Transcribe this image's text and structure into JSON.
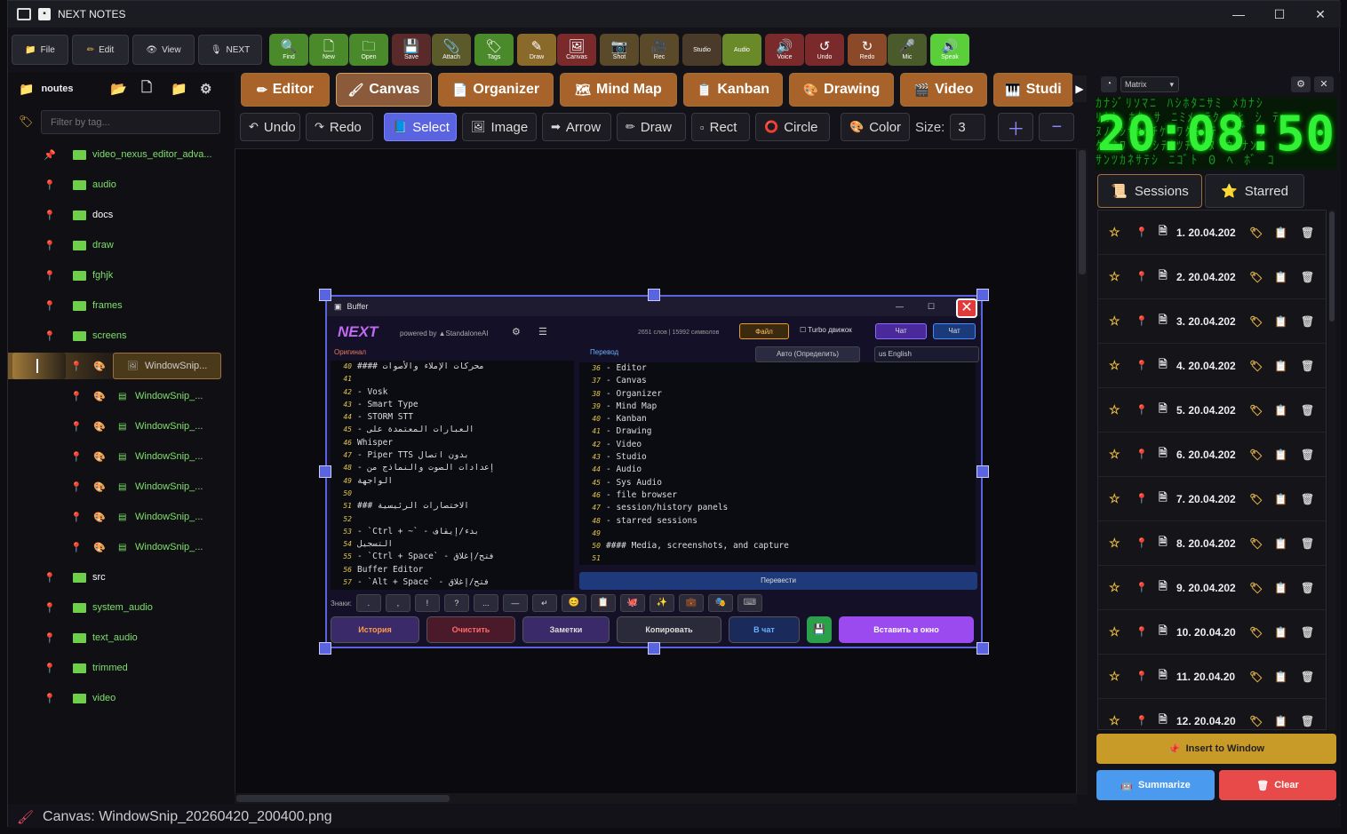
{
  "window": {
    "title": "NEXT NOTES"
  },
  "menus": [
    {
      "label": "File"
    },
    {
      "label": "Edit"
    },
    {
      "label": "View"
    },
    {
      "label": "NEXT"
    }
  ],
  "toolbar": [
    {
      "label": "Find",
      "icon": "🔍",
      "color": "#4a8a2a"
    },
    {
      "label": "New",
      "icon": "🗋",
      "color": "#4a8a2a"
    },
    {
      "label": "Open",
      "icon": "🗀",
      "color": "#4a8a2a"
    },
    {
      "label": "Save",
      "icon": "💾",
      "color": "#5a2a2a"
    },
    {
      "label": "Attach",
      "icon": "📎",
      "color": "#5a5a2a"
    },
    {
      "label": "Tags",
      "icon": "🏷",
      "color": "#4a8a2a"
    },
    {
      "label": "Draw",
      "icon": "✎",
      "color": "#8a6a2a"
    },
    {
      "label": "Canvas",
      "icon": "🖼",
      "color": "#7a2a2a"
    },
    {
      "label": "Shot",
      "icon": "📷",
      "color": "#5a4a2a"
    },
    {
      "label": "Rec",
      "icon": "🎥",
      "color": "#5a4a2a"
    },
    {
      "label": "Studio",
      "icon": "",
      "color": "#4a3a2a"
    },
    {
      "label": "Audio",
      "icon": "",
      "color": "#6a8a2a"
    },
    {
      "label": "Voice",
      "icon": "🔊",
      "color": "#7a2a2a"
    },
    {
      "label": "Undo",
      "icon": "↺",
      "color": "#7a2a2a"
    },
    {
      "label": "Redo",
      "icon": "↻",
      "color": "#8a4a2a"
    },
    {
      "label": "Mic",
      "icon": "🎤",
      "color": "#4a5a2a"
    },
    {
      "label": "Speak",
      "icon": "🔊",
      "color": "#5acf3a"
    }
  ],
  "sidebar": {
    "root": "noutes",
    "filter_placeholder": "Filter by tag...",
    "items": [
      {
        "label": "video_nexus_editor_adva...",
        "pin": "📌"
      },
      {
        "label": "audio"
      },
      {
        "label": "docs"
      },
      {
        "label": "draw"
      },
      {
        "label": "fghjk"
      },
      {
        "label": "frames"
      },
      {
        "label": "screens"
      }
    ],
    "files": [
      {
        "label": "WindowSnip..."
      },
      {
        "label": "WindowSnip_..."
      },
      {
        "label": "WindowSnip_..."
      },
      {
        "label": "WindowSnip_..."
      },
      {
        "label": "WindowSnip_..."
      },
      {
        "label": "WindowSnip_..."
      },
      {
        "label": "WindowSnip_..."
      }
    ],
    "items2": [
      {
        "label": "src"
      },
      {
        "label": "system_audio"
      },
      {
        "label": "text_audio"
      },
      {
        "label": "trimmed"
      },
      {
        "label": "video"
      }
    ]
  },
  "tabs": [
    {
      "label": "Editor",
      "icon": "✏",
      "color": "#a8632a"
    },
    {
      "label": "Canvas",
      "icon": "🖌",
      "color": "#8a5a3a"
    },
    {
      "label": "Organizer",
      "icon": "📄",
      "color": "#a8632a"
    },
    {
      "label": "Mind Map",
      "icon": "🗺",
      "color": "#a8632a"
    },
    {
      "label": "Kanban",
      "icon": "📋",
      "color": "#a8632a"
    },
    {
      "label": "Drawing",
      "icon": "🎨",
      "color": "#a8632a"
    },
    {
      "label": "Video",
      "icon": "🎬",
      "color": "#a8632a"
    },
    {
      "label": "Studi",
      "icon": "🎹",
      "color": "#a8632a"
    }
  ],
  "canvas_tools": [
    {
      "label": "Undo",
      "icon": "↶"
    },
    {
      "label": "Redo",
      "icon": "↷"
    },
    {
      "label": "Select",
      "icon": "📘",
      "active": true
    },
    {
      "label": "Image",
      "icon": "🖼"
    },
    {
      "label": "Arrow",
      "icon": "➡"
    },
    {
      "label": "Draw",
      "icon": "✏"
    },
    {
      "label": "Rect",
      "icon": "▫"
    },
    {
      "label": "Circle",
      "icon": "⭕"
    },
    {
      "label": "Color",
      "icon": "🎨"
    }
  ],
  "size": {
    "label": "Size:",
    "value": "3"
  },
  "snip": {
    "title": "Buffer",
    "brand": "NEXT",
    "powered": "powered by ▲StandaloneAI",
    "stats": "2651 слов | 15992 символов",
    "file_btn": "Файл",
    "turbo": "Turbo движок",
    "chat_btn1": "Чат",
    "chat_btn2": "Чат",
    "orig_label": "Оригинал",
    "trans_label": "Перевод",
    "auto_lang": "Авто (Определить)",
    "target_lang": "us English",
    "left_lines": [
      {
        "n": "40",
        "t": "#### محركات الإملاء والأصوات"
      },
      {
        "n": "41",
        "t": ""
      },
      {
        "n": "42",
        "t": "- Vosk"
      },
      {
        "n": "43",
        "t": "- Smart Type"
      },
      {
        "n": "44",
        "t": "- STORM STT"
      },
      {
        "n": "45",
        "t": "- العبارات المعتمدة على"
      },
      {
        "n": "46",
        "t": "Whisper"
      },
      {
        "n": "47",
        "t": "- Piper TTS بدون اتصال"
      },
      {
        "n": "48",
        "t": "- إعدادات الصوت والنماذج من"
      },
      {
        "n": "49",
        "t": "الواجهة"
      },
      {
        "n": "50",
        "t": ""
      },
      {
        "n": "51",
        "t": "### الاختصارات الرئيسية"
      },
      {
        "n": "52",
        "t": ""
      },
      {
        "n": "53",
        "t": "- `Ctrl + ~` - بدء/إيقاف"
      },
      {
        "n": "54",
        "t": "التسجيل"
      },
      {
        "n": "55",
        "t": "- `Ctrl + Space` - فتح/إغلاق"
      },
      {
        "n": "56",
        "t": "Buffer Editor"
      },
      {
        "n": "57",
        "t": "- `Alt + Space` - فتح/إغلاق"
      }
    ],
    "right_lines": [
      {
        "n": "36",
        "t": "- Editor"
      },
      {
        "n": "37",
        "t": "- Canvas"
      },
      {
        "n": "38",
        "t": "- Organizer"
      },
      {
        "n": "39",
        "t": "- Mind Map"
      },
      {
        "n": "40",
        "t": "- Kanban"
      },
      {
        "n": "41",
        "t": "- Drawing"
      },
      {
        "n": "42",
        "t": "- Video"
      },
      {
        "n": "43",
        "t": "- Studio"
      },
      {
        "n": "44",
        "t": "- Audio"
      },
      {
        "n": "45",
        "t": "- Sys Audio"
      },
      {
        "n": "46",
        "t": "- file browser"
      },
      {
        "n": "47",
        "t": "- session/history panels"
      },
      {
        "n": "48",
        "t": "- starred sessions"
      },
      {
        "n": "49",
        "t": ""
      },
      {
        "n": "50",
        "t": "#### Media, screenshots, and capture"
      },
      {
        "n": "51",
        "t": ""
      }
    ],
    "translate_btn": "Перевести",
    "signs_label": "Знаки:",
    "sign_keys": [
      ".",
      ",",
      "!",
      "?",
      "...",
      "—",
      "↵"
    ],
    "history_btn": "История",
    "clear_btn": "Очистить",
    "notes_btn": "Заметки",
    "copy_btn": "Копировать",
    "to_chat_btn": "В чат",
    "insert_btn": "Вставить в окно"
  },
  "right_panel": {
    "theme": "Matrix",
    "clock": "20:08:50",
    "tab_sessions": "Sessions",
    "tab_starred": "Starred",
    "sessions": [
      {
        "label": "1. 20.04.202"
      },
      {
        "label": "2. 20.04.202"
      },
      {
        "label": "3. 20.04.202"
      },
      {
        "label": "4. 20.04.202"
      },
      {
        "label": "5. 20.04.202"
      },
      {
        "label": "6. 20.04.202"
      },
      {
        "label": "7. 20.04.202"
      },
      {
        "label": "8. 20.04.202"
      },
      {
        "label": "9. 20.04.202"
      },
      {
        "label": "10. 20.04.20"
      },
      {
        "label": "11. 20.04.20"
      },
      {
        "label": "12. 20.04.20"
      }
    ],
    "insert_btn": "Insert to Window",
    "summarize_btn": "Summarize",
    "clear_btn": "Clear"
  },
  "status": {
    "text": "Canvas: WindowSnip_20260420_200400.png"
  }
}
